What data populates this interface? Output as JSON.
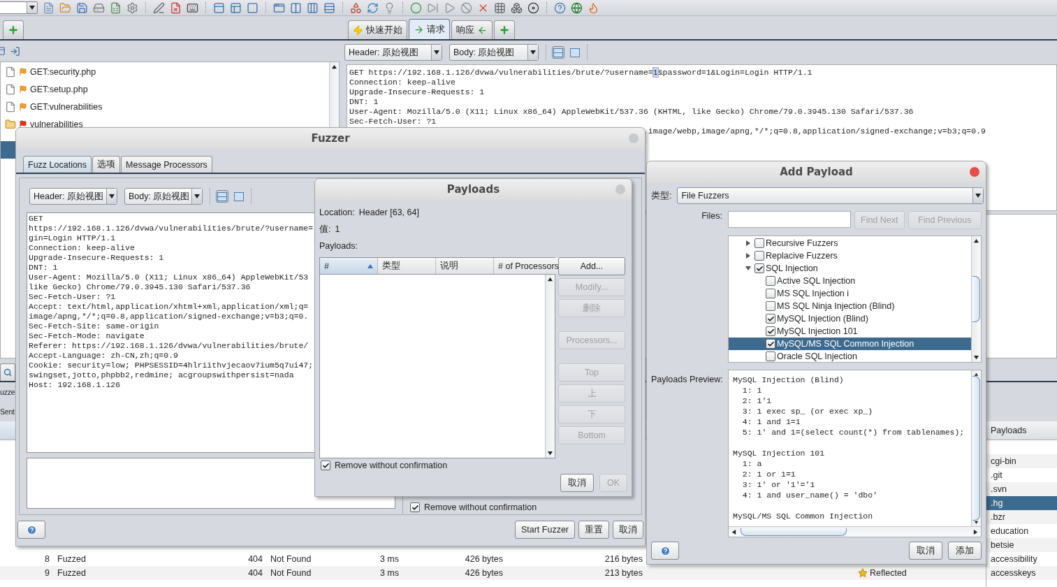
{
  "left_panel": {
    "tree": [
      {
        "label": "GET:security.php",
        "kind": "file"
      },
      {
        "label": "GET:setup.php",
        "kind": "file"
      },
      {
        "label": "GET:vulnerabilities",
        "kind": "file"
      },
      {
        "label": "vulnerabilities",
        "kind": "folder"
      }
    ]
  },
  "request_tabs": [
    {
      "label": "快速开始",
      "selected": false
    },
    {
      "label": "请求",
      "selected": true
    },
    {
      "label": "响应",
      "selected": false
    }
  ],
  "request_view": {
    "header_select": "Header: 原始视图",
    "body_select": "Body: 原始视图",
    "view_modes": [
      {
        "selected": true
      },
      {
        "selected": false
      }
    ]
  },
  "request": {
    "first_line": [
      {
        "text": "GET https://192.168.1.126/dvwa/vulnerabilities/brute/?username=",
        "selected": false
      },
      {
        "text": "1",
        "selected": true
      },
      {
        "text": "&password=1&Login=Login HTTP/1.1",
        "selected": false
      }
    ],
    "lines": [
      "Connection: keep-alive",
      "Upgrade-Insecure-Requests: 1",
      "DNT: 1",
      "User-Agent: Mozilla/5.0 (X11; Linux x86_64) AppleWebKit/537.36 (KHTML, like Gecko) Chrome/79.0.3945.130 Safari/537.36",
      "Sec-Fetch-User: ?1"
    ],
    "fragment": ",image/webp,image/apng,*/*;q=0.8,application/signed-exchange;v=b3;q=0.9"
  },
  "results": {
    "tab_fragment": "uzze",
    "column_fragment": "Sent",
    "rows": [
      {
        "cells": [
          "8",
          "Fuzzed",
          "404",
          "Not Found",
          "3 ms",
          "426 bytes",
          "216 bytes"
        ]
      },
      {
        "cells": [
          "9",
          "Fuzzed",
          "404",
          "Not Found",
          "3 ms",
          "426 bytes",
          "213 bytes"
        ],
        "state": "Reflected"
      }
    ]
  },
  "payload_list": {
    "header": "Payloads",
    "items": [
      {
        "label": "cgi-bin",
        "selected": false
      },
      {
        "label": ".git",
        "selected": false
      },
      {
        "label": ".svn",
        "selected": false
      },
      {
        "label": ".hg",
        "selected": true
      },
      {
        "label": ".bzr",
        "selected": false
      },
      {
        "label": "education",
        "selected": false
      },
      {
        "label": "betsie",
        "selected": false
      },
      {
        "label": "accessibility",
        "selected": false
      },
      {
        "label": "accesskeys",
        "selected": false
      }
    ]
  },
  "fuzzer": {
    "title": "Fuzzer",
    "focused": false,
    "tabs": [
      {
        "label": "Fuzz Locations",
        "selected": true
      },
      {
        "label": "选项",
        "selected": false
      },
      {
        "label": "Message Processors",
        "selected": false
      }
    ],
    "header_select": "Header: 原始视图",
    "body_select": "Body: 原始视图",
    "view_modes": [
      {
        "selected": true
      },
      {
        "selected": false
      }
    ],
    "request_lines": [
      "GET",
      "https://192.168.1.126/dvwa/vulnerabilities/brute/?username=",
      "gin=Login HTTP/1.1",
      "Connection: keep-alive",
      "Upgrade-Insecure-Requests: 1",
      "DNT: 1",
      "User-Agent: Mozilla/5.0 (X11; Linux x86_64) AppleWebKit/53",
      "like Gecko) Chrome/79.0.3945.130 Safari/537.36",
      "Sec-Fetch-User: ?1",
      "Accept: text/html,application/xhtml+xml,application/xml;q=",
      "image/apng,*/*;q=0.8,application/signed-exchange;v=b3;q=0.",
      "Sec-Fetch-Site: same-origin",
      "Sec-Fetch-Mode: navigate",
      "Referer: https://192.168.1.126/dvwa/vulnerabilities/brute/",
      "Accept-Language: zh-CN,zh;q=0.9",
      "Cookie: security=low; PHPSESSID=4hlriithvjecaov7ium5q7ui47;",
      "swingset,jotto,phpbb2,redmine; acgroupswithpersist=nada",
      "Host: 192.168.1.126"
    ],
    "remove_without_confirmation": {
      "label": "Remove without confirmation",
      "checked": true
    },
    "buttons": [
      {
        "label": "Start Fuzzer"
      },
      {
        "label": "重置"
      },
      {
        "label": "取消"
      }
    ]
  },
  "payloads_dialog": {
    "title": "Payloads",
    "focused": false,
    "location_label": "Location:",
    "location": "Header [63, 64]",
    "value_label": "值:",
    "value": "1",
    "payloads_label": "Payloads:",
    "columns": [
      {
        "label": "#",
        "sorted": true
      },
      {
        "label": "类型",
        "sorted": false
      },
      {
        "label": "说明",
        "sorted": false
      },
      {
        "label": "# of Processors",
        "sorted": false
      }
    ],
    "buttons": [
      {
        "label": "Add...",
        "disabled": false,
        "gap_before": false
      },
      {
        "label": "Modify...",
        "disabled": true,
        "gap_before": false
      },
      {
        "label": "删除",
        "disabled": true,
        "gap_before": false
      },
      {
        "label": "Processors...",
        "disabled": true,
        "gap_before": true
      },
      {
        "label": "Top",
        "disabled": true,
        "gap_before": true
      },
      {
        "label": "上",
        "disabled": true,
        "gap_before": false
      },
      {
        "label": "下",
        "disabled": true,
        "gap_before": false
      },
      {
        "label": "Bottom",
        "disabled": true,
        "gap_before": false
      }
    ],
    "remove_without_confirmation": {
      "label": "Remove without confirmation",
      "checked": true
    },
    "footer_buttons": [
      {
        "label": "取消",
        "disabled": false
      },
      {
        "label": "OK",
        "disabled": true
      }
    ]
  },
  "add_payload": {
    "title": "Add Payload",
    "focused": true,
    "type_label": "类型:",
    "type_value": "File Fuzzers",
    "files_label": "Files:",
    "find_buttons": [
      {
        "label": "Find Next",
        "disabled": true
      },
      {
        "label": "Find Previous",
        "disabled": true
      }
    ],
    "tree": [
      {
        "label": "Recursive Fuzzers",
        "checked": false,
        "selected": false,
        "expanded": false
      },
      {
        "label": "Replacive Fuzzers",
        "checked": false,
        "selected": false,
        "expanded": false
      },
      {
        "label": "SQL Injection",
        "checked": true,
        "selected": false,
        "expanded": true,
        "children": [
          {
            "label": "Active SQL Injection",
            "checked": false,
            "selected": false
          },
          {
            "label": "MS SQL Injection i",
            "checked": false,
            "selected": false
          },
          {
            "label": "MS SQL Ninja Injection (Blind)",
            "checked": false,
            "selected": false
          },
          {
            "label": "MySQL Injection (Blind)",
            "checked": true,
            "selected": false
          },
          {
            "label": "MySQL Injection 101",
            "checked": true,
            "selected": false
          },
          {
            "label": "MySQL/MS SQL Common Injection",
            "checked": true,
            "selected": true
          },
          {
            "label": "Oracle SQL Injection",
            "checked": false,
            "selected": false
          }
        ]
      }
    ],
    "preview_label": "Payloads Preview:",
    "preview": [
      {
        "title": "MySQL Injection (Blind)",
        "lines": [
          "  1: 1",
          "  2: 1'1",
          "  3: 1 exec sp_ (or exec xp_)",
          "  4: 1 and 1=1",
          "  5: 1' and 1=(select count(*) from tablenames);"
        ]
      },
      {
        "title": "MySQL Injection 101",
        "lines": [
          "  1: a",
          "  2: 1 or 1=1",
          "  3: 1' or '1'='1",
          "  4: 1 and user_name() = 'dbo'"
        ]
      },
      {
        "title": "MySQL/MS SQL Common Injection"
      }
    ],
    "buttons": [
      {
        "label": "取消"
      },
      {
        "label": "添加"
      }
    ]
  }
}
